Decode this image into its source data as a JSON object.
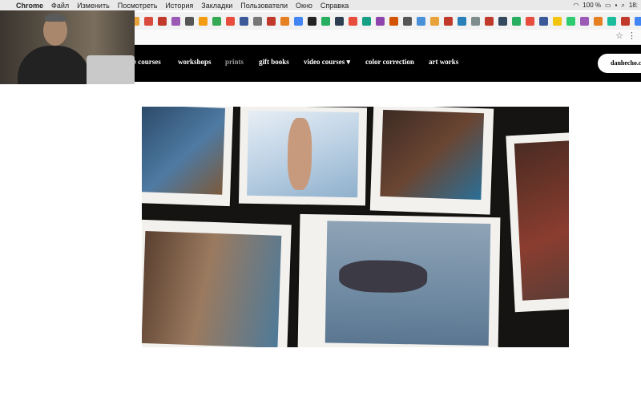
{
  "os_menubar": {
    "app_name": "Chrome",
    "items": [
      "Файл",
      "Изменить",
      "Посмотреть",
      "История",
      "Закладки",
      "Пользователи",
      "Окно",
      "Справка"
    ],
    "battery": "100 %",
    "clock": "18:"
  },
  "browser": {
    "bookmark_colors": [
      "#e8a23a",
      "#d84a3c",
      "#c0392b",
      "#9b59b6",
      "#555555",
      "#f39c12",
      "#34a853",
      "#e74c3c",
      "#3b5998",
      "#777777",
      "#c0392b",
      "#e67e22",
      "#4285f4",
      "#222222",
      "#27ae60",
      "#2c3e50",
      "#e74c3c",
      "#16a085",
      "#8e44ad",
      "#d35400",
      "#555555",
      "#4a90d9",
      "#e8a23a",
      "#c0392b",
      "#2980b9",
      "#7f8c8d",
      "#c0392b",
      "#34495e",
      "#27ae60",
      "#e74c3c",
      "#3b5998",
      "#f1c40f",
      "#2ecc71",
      "#9b59b6",
      "#e67e22",
      "#1abc9c",
      "#c0392b",
      "#4285f4",
      "#d84a3c"
    ]
  },
  "site_nav": {
    "links": [
      {
        "label": "e courses",
        "muted": false
      },
      {
        "label": "workshops",
        "muted": false
      },
      {
        "label": "prints",
        "muted": true
      },
      {
        "label": "gift books",
        "muted": false
      },
      {
        "label": "video courses ▾",
        "muted": false
      },
      {
        "label": "color correction",
        "muted": false
      },
      {
        "label": "art works",
        "muted": false
      }
    ],
    "login_label": "danhecho.c"
  },
  "colors": {
    "nav_bg": "#000000",
    "active_muted": "#9a9a9a"
  }
}
